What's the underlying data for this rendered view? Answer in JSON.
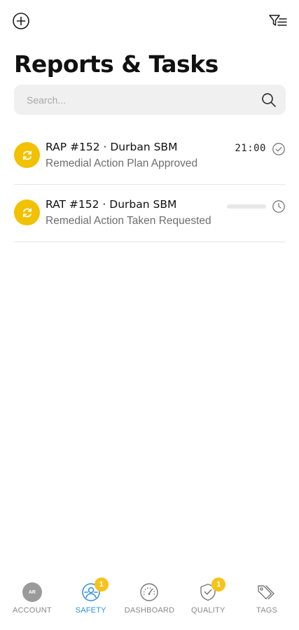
{
  "header": {
    "title": "Reports & Tasks",
    "add_icon": "plus-circle-icon",
    "filter_icon": "filter-list-icon"
  },
  "search": {
    "placeholder": "Search...",
    "value": "",
    "icon": "search-icon"
  },
  "items": [
    {
      "title": "RAP #152 · Durban SBM",
      "subtitle": "Remedial Action Plan Approved",
      "time": "21:00",
      "status_icon": "check-circle-icon",
      "type_icon": "refresh-icon"
    },
    {
      "title": "RAT #152 · Durban SBM",
      "subtitle": "Remedial Action Taken Requested",
      "time": "",
      "status_icon": "clock-icon",
      "type_icon": "refresh-icon"
    }
  ],
  "nav": {
    "items": [
      {
        "label": "ACCOUNT",
        "icon": "avatar",
        "avatar_text": "AR",
        "badge": ""
      },
      {
        "label": "SAFETY",
        "icon": "safety-icon",
        "badge": "1",
        "active": true
      },
      {
        "label": "DASHBOARD",
        "icon": "gauge-icon",
        "badge": ""
      },
      {
        "label": "QUALITY",
        "icon": "shield-check-icon",
        "badge": "1"
      },
      {
        "label": "TAGS",
        "icon": "tags-icon",
        "badge": ""
      }
    ]
  },
  "colors": {
    "accent_yellow": "#f2c100",
    "active_blue": "#2c8fe0",
    "inactive_gray": "#888888",
    "search_bg": "#f0f0f0"
  }
}
